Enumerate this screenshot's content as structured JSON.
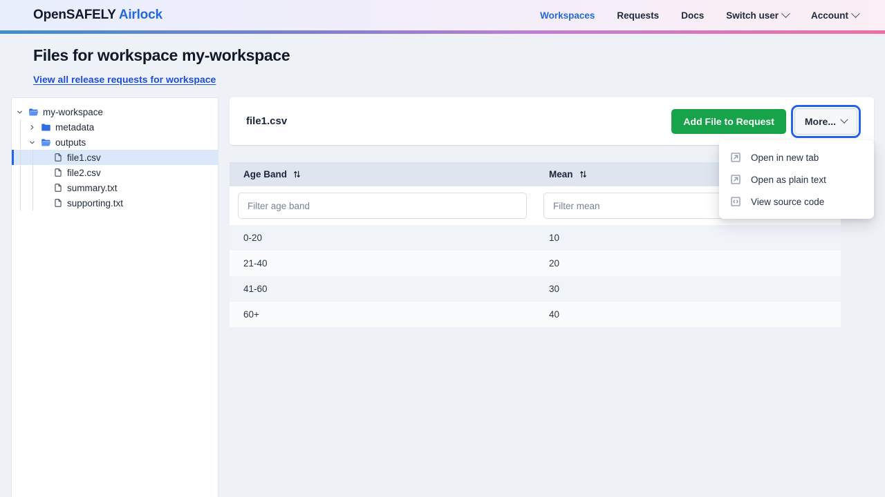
{
  "navbar": {
    "brand_primary": "OpenSAFELY",
    "brand_accent": "Airlock",
    "links": [
      {
        "label": "Workspaces",
        "active": true,
        "caret": false
      },
      {
        "label": "Requests",
        "active": false,
        "caret": false
      },
      {
        "label": "Docs",
        "active": false,
        "caret": false
      },
      {
        "label": "Switch user",
        "active": false,
        "caret": true
      },
      {
        "label": "Account",
        "active": false,
        "caret": true
      }
    ]
  },
  "page": {
    "title": "Files for workspace my-workspace",
    "sublink": "View all release requests for workspace"
  },
  "tree": {
    "nodes": [
      {
        "label": "my-workspace",
        "icon": "folder-open-icon",
        "twisty": "chevron-down-icon",
        "depth": 0,
        "selected": false
      },
      {
        "label": "metadata",
        "icon": "folder-closed-icon",
        "twisty": "chevron-right-icon",
        "depth": 1,
        "selected": false
      },
      {
        "label": "outputs",
        "icon": "folder-open-icon",
        "twisty": "chevron-down-icon",
        "depth": 1,
        "selected": false
      },
      {
        "label": "file1.csv",
        "icon": "file-icon",
        "twisty": "",
        "depth": 2,
        "selected": true
      },
      {
        "label": "file2.csv",
        "icon": "file-icon",
        "twisty": "",
        "depth": 2,
        "selected": false
      },
      {
        "label": "summary.txt",
        "icon": "file-icon",
        "twisty": "",
        "depth": 2,
        "selected": false
      },
      {
        "label": "supporting.txt",
        "icon": "file-icon",
        "twisty": "",
        "depth": 2,
        "selected": false
      }
    ]
  },
  "file_card": {
    "file_name": "file1.csv",
    "add_to_request_label": "Add File to Request",
    "more_label": "More..."
  },
  "dropdown": {
    "items": [
      {
        "label": "Open in new tab",
        "icon": "external-link-icon"
      },
      {
        "label": "Open as plain text",
        "icon": "external-link-icon"
      },
      {
        "label": "View source code",
        "icon": "code-icon"
      }
    ]
  },
  "table": {
    "columns": [
      {
        "label": "Age Band",
        "sort_icon": "sort-icon",
        "filter_placeholder": "Filter age band"
      },
      {
        "label": "Mean",
        "sort_icon": "sort-icon",
        "filter_placeholder": "Filter mean"
      }
    ],
    "rows": [
      [
        "0-20",
        "10"
      ],
      [
        "21-40",
        "20"
      ],
      [
        "41-60",
        "30"
      ],
      [
        "60+",
        "40"
      ]
    ]
  },
  "colors": {
    "accent_blue": "#2468e0",
    "primary_green": "#16a34a",
    "focus_ring": "#2563eb",
    "selected_row": "#dbe7fb",
    "page_bg": "#eef1f6"
  }
}
